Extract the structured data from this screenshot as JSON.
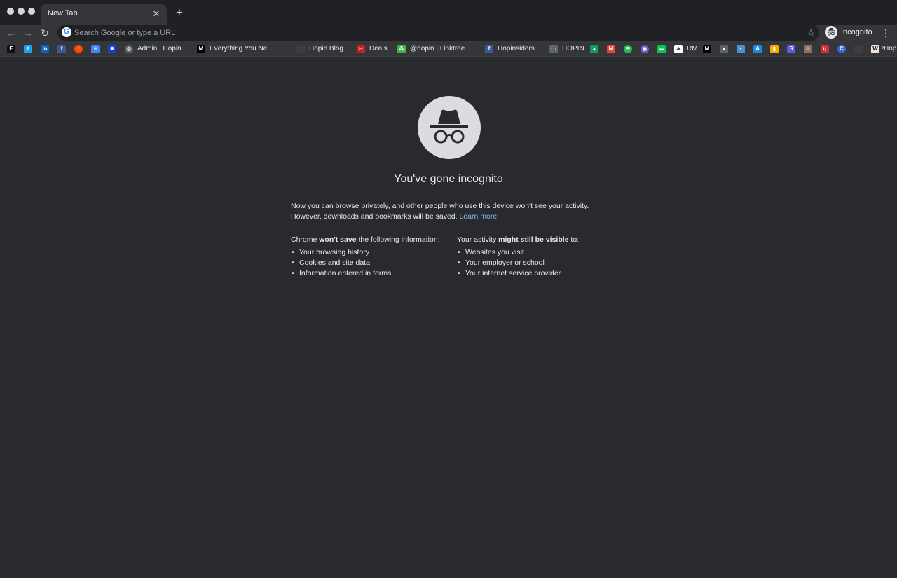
{
  "window": {
    "traffic_lights": [
      "close",
      "minimize",
      "zoom"
    ]
  },
  "tab": {
    "title": "New Tab",
    "close_glyph": "✕",
    "new_tab_glyph": "+"
  },
  "toolbar": {
    "back_glyph": "←",
    "forward_glyph": "→",
    "reload_glyph": "↻",
    "omnibox_placeholder": "Search Google or type a URL",
    "google_logo_letter": "G",
    "star_glyph": "☆",
    "profile_label": "Incognito",
    "menu_glyph": "⋮"
  },
  "bookmarks": [
    {
      "name": "bookmark-e",
      "icon": "E",
      "label": "",
      "color": "#111111"
    },
    {
      "name": "bookmark-twitter",
      "icon": "t",
      "label": "",
      "color": "#1da1f2"
    },
    {
      "name": "bookmark-linkedin",
      "icon": "in",
      "label": "",
      "color": "#0a66c2"
    },
    {
      "name": "bookmark-facebook",
      "icon": "f",
      "label": "",
      "color": "#3b5998"
    },
    {
      "name": "bookmark-reddit",
      "icon": "r",
      "label": "",
      "color": "#ff4500"
    },
    {
      "name": "bookmark-docs",
      "icon": "≡",
      "label": "",
      "color": "#4285f4"
    },
    {
      "name": "bookmark-settings",
      "icon": "✹",
      "label": "",
      "color": "#1a3fd8"
    },
    {
      "name": "bookmark-admin-hopin",
      "icon": "◍",
      "label": "Admin | Hopin",
      "color": "#5f6368"
    },
    {
      "name": "bookmark-medium",
      "icon": "M",
      "label": "Everything You Ne...",
      "color": "#000000"
    },
    {
      "name": "bookmark-hopin-blog",
      "icon": "",
      "label": "Hopin Blog",
      "color": "#3c3d41"
    },
    {
      "name": "bookmark-deals",
      "icon": "✂",
      "label": "Deals",
      "color": "#c5221f"
    },
    {
      "name": "bookmark-linktree",
      "icon": "⁂",
      "label": "@hopin | Linktree",
      "color": "#39b54a"
    },
    {
      "name": "bookmark-hopinsiders",
      "icon": "f",
      "label": "Hopinsiders",
      "color": "#3b5998"
    },
    {
      "name": "bookmark-folder-hopin",
      "icon": "▭",
      "label": "HOPIN",
      "color": "#5f6368"
    },
    {
      "name": "bookmark-drive",
      "icon": "▲",
      "label": "",
      "color": "#0f9d58"
    },
    {
      "name": "bookmark-gmail",
      "icon": "M",
      "label": "",
      "color": "#ea4335"
    },
    {
      "name": "bookmark-spotify",
      "icon": "≋",
      "label": "",
      "color": "#1db954"
    },
    {
      "name": "bookmark-purple",
      "icon": "◉",
      "label": "",
      "color": "#6a5acd"
    },
    {
      "name": "bookmark-messages",
      "icon": "▬",
      "label": "",
      "color": "#00c853"
    },
    {
      "name": "bookmark-amazon",
      "icon": "a",
      "label": "RM",
      "color": "#ffffff"
    },
    {
      "name": "bookmark-medium-2",
      "icon": "M",
      "label": "",
      "color": "#000000"
    },
    {
      "name": "bookmark-apple",
      "icon": "●",
      "label": "",
      "color": "#5f6368"
    },
    {
      "name": "bookmark-chat",
      "icon": "▪",
      "label": "",
      "color": "#4a90d9"
    },
    {
      "name": "bookmark-appstore",
      "icon": "A",
      "label": "",
      "color": "#1e88e5"
    },
    {
      "name": "bookmark-analytics",
      "icon": "▮",
      "label": "",
      "color": "#f9ab00"
    },
    {
      "name": "bookmark-s",
      "icon": "S",
      "label": "",
      "color": "#5c5ce0"
    },
    {
      "name": "bookmark-avatar",
      "icon": "☺",
      "label": "",
      "color": "#8d6e63"
    },
    {
      "name": "bookmark-red",
      "icon": "ɥ",
      "label": "",
      "color": "#d32f2f"
    },
    {
      "name": "bookmark-c",
      "icon": "C",
      "label": "",
      "color": "#3367d6"
    },
    {
      "name": "bookmark-dark",
      "icon": "",
      "label": "",
      "color": "#3c3d41"
    },
    {
      "name": "bookmark-hopin",
      "icon": "W",
      "label": "Hopin",
      "color": "#f1e4dc"
    },
    {
      "name": "bookmark-green",
      "icon": "⬦",
      "label": "",
      "color": "#2e7d32"
    }
  ],
  "bookmarks_overflow": "»",
  "ntp": {
    "headline": "You've gone incognito",
    "subtitle_line1": "Now you can browse privately, and other people who use this device won't see your activity.",
    "subtitle_line2": "However, downloads and bookmarks will be saved.",
    "learn_more": "Learn more",
    "left_column": {
      "head_prefix": "Chrome ",
      "head_bold": "won't save",
      "head_suffix": " the following information:",
      "items": [
        "Your browsing history",
        "Cookies and site data",
        "Information entered in forms"
      ]
    },
    "right_column": {
      "head_prefix": "Your activity ",
      "head_bold": "might still be visible",
      "head_suffix": " to:",
      "items": [
        "Websites you visit",
        "Your employer or school",
        "Your internet service provider"
      ]
    }
  },
  "colors": {
    "page_background": "#292a2d",
    "toolbar_background": "#35363a",
    "tabstrip_background": "#202124",
    "link": "#8ab4f8"
  }
}
